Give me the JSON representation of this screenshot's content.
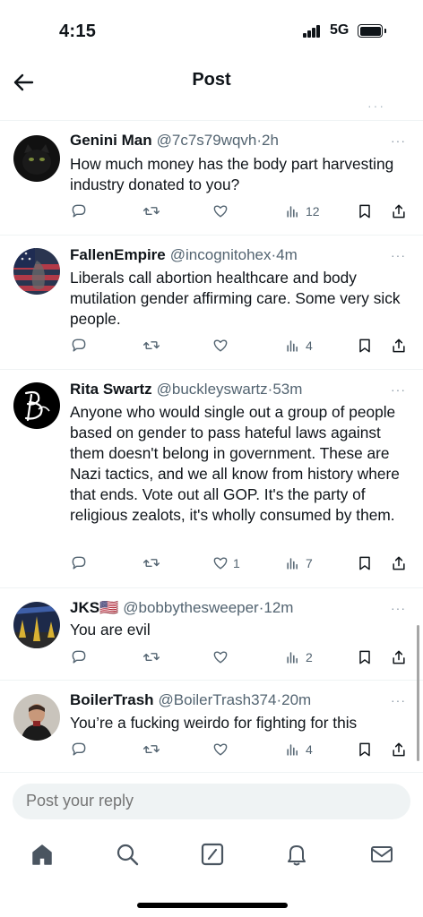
{
  "status_bar": {
    "time": "4:15",
    "network": "5G"
  },
  "header": {
    "title": "Post"
  },
  "icons": {
    "back": "arrow-left-icon",
    "reply": "comment-bubble-icon",
    "repost": "repost-arrows-icon",
    "like": "heart-icon",
    "views": "bar-chart-icon",
    "bookmark": "bookmark-icon",
    "share": "share-upload-icon",
    "more": "ellipsis-icon"
  },
  "replies": [
    {
      "name": "Genini Man",
      "handle": "@7c7s79wqvh",
      "time": "·2h",
      "text": "How much money has the body part harvesting industry donated to you?",
      "likes": "",
      "views": "12"
    },
    {
      "name": "FallenEmpire",
      "handle": "@incognitohex",
      "time": "·4m",
      "text": "Liberals call abortion healthcare and body mutilation gender affirming care.  Some very sick people.",
      "likes": "",
      "views": "4"
    },
    {
      "name": "Rita Swartz",
      "handle": "@buckleyswartz",
      "time": "·53m",
      "text": "Anyone who would single out a group of people based on gender to pass hateful laws against them doesn't belong in government. These are Nazi tactics, and we all know from history where that ends. Vote out all GOP. It's the party of religious zealots, it's wholly consumed by them.",
      "likes": "1",
      "views": "7"
    },
    {
      "name": "JKS🇺🇸",
      "handle": "@bobbythesweeper",
      "time": "·12m",
      "text": "You are evil",
      "likes": "",
      "views": "2"
    },
    {
      "name": "BoilerTrash",
      "handle": "@BoilerTrash374",
      "time": "·20m",
      "text": "You’re a fucking weirdo for fighting for this",
      "likes": "",
      "views": "4"
    }
  ],
  "composer": {
    "placeholder": "Post your reply"
  },
  "tabs": [
    "home-icon",
    "search-icon",
    "compose-icon",
    "notifications-bell-icon",
    "messages-envelope-icon"
  ],
  "colors": {
    "text": "#0f1419",
    "secondary": "#536471",
    "divider": "#eff3f4",
    "composer_bg": "#eff3f4"
  }
}
